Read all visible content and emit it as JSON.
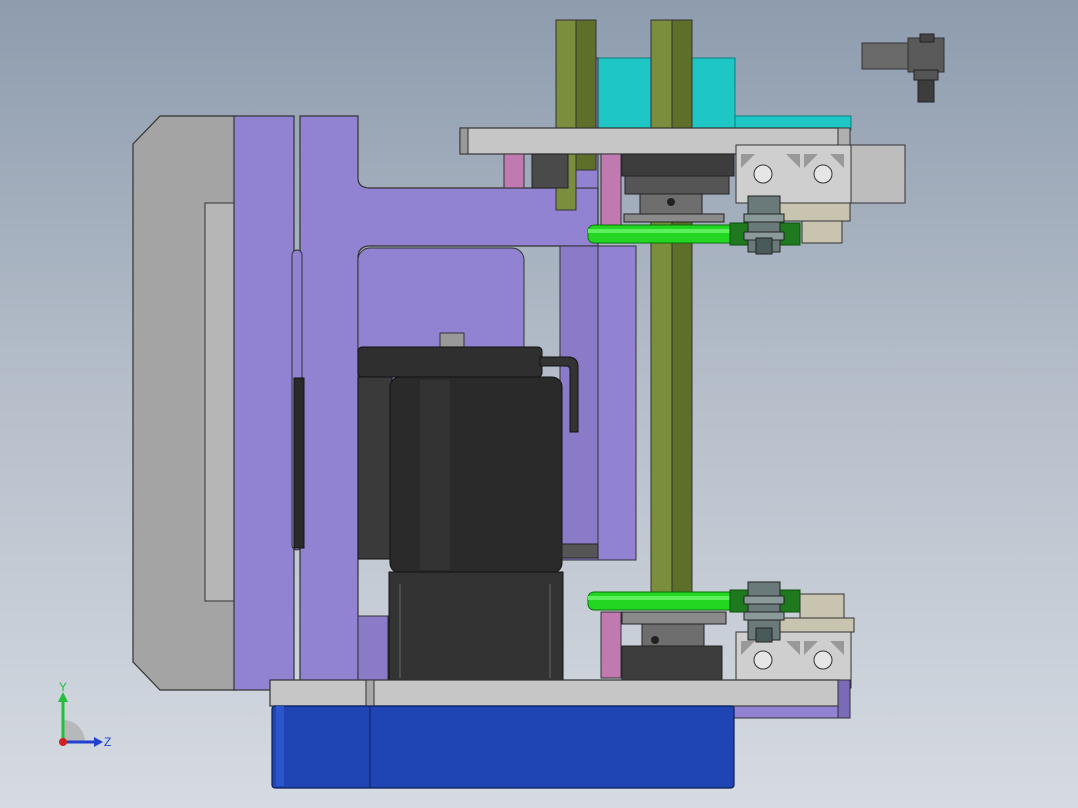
{
  "viewport": {
    "background_top": "#8e9cae",
    "background_bottom": "#d6dbe2"
  },
  "model": {
    "colors": {
      "frame_gray": "#a4a4a4",
      "frame_gray_light": "#c6c6c6",
      "plate_purple": "#9282d2",
      "plate_purple_dark": "#7a6ab8",
      "motor_black": "#2a2a2a",
      "motor_dark": "#3a3a3a",
      "belt_green": "#22d622",
      "rail_olive": "#7a8e3e",
      "rail_olive_dark": "#5e6f2a",
      "bracket_cyan": "#1ec6c6",
      "base_blue": "#1f45b4",
      "pin_pink": "#c07ab0",
      "extrusion_silver": "#cfcfcf",
      "bracket_tan": "#c9c4b0"
    }
  },
  "triad": {
    "y_label": "Y",
    "z_label": "Z",
    "y_color": "#22c03a",
    "z_color": "#2040d0",
    "x_color": "#d02020"
  }
}
